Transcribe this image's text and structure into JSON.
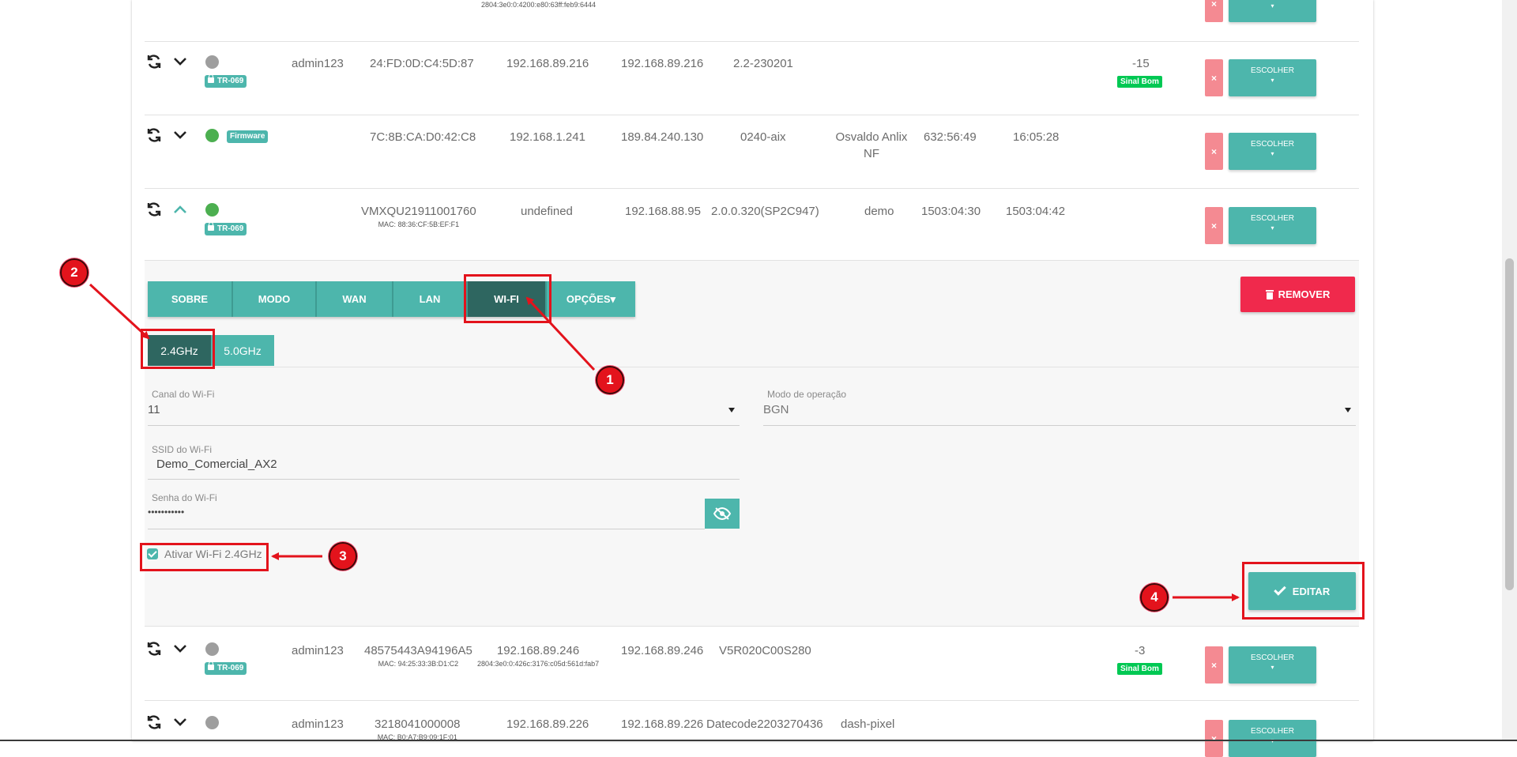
{
  "rows": [
    {
      "id": "row-top-partial",
      "ip_sub": "2804:3e0:0:4200:e80:63ff:feb9:6444"
    },
    {
      "id": "row-1",
      "status": "gray",
      "tag": "TR-069",
      "user": "admin123",
      "mac": "24:FD:0D:C4:5D:87",
      "ip_local": "192.168.89.216",
      "ip_public": "192.168.89.216",
      "version": "2.2-230201",
      "signal": "-15",
      "signal_badge": "Sinal Bom"
    },
    {
      "id": "row-2",
      "status": "green",
      "tag": "Firmware",
      "mac": "7C:8B:CA:D0:42:C8",
      "ip_local": "192.168.1.241",
      "ip_public": "189.84.240.130",
      "version": "0240-aix",
      "name_line1": "Osvaldo Anlix",
      "name_line2": "NF",
      "uptime": "632:56:49",
      "conn_time": "16:05:28"
    },
    {
      "id": "row-3",
      "status": "green",
      "tag": "TR-069",
      "serial": "VMXQU21911001760",
      "serial_sub": "MAC: 88:36:CF:5B:EF:F1",
      "user": "undefined",
      "ip_local": "192.168.88.95",
      "version": "2.0.0.320(SP2C947)",
      "name": "demo",
      "uptime": "1503:04:30",
      "conn_time": "1503:04:42"
    },
    {
      "id": "row-4",
      "status": "gray",
      "tag": "TR-069",
      "user": "admin123",
      "serial": "48575443A94196A5",
      "serial_sub": "MAC: 94:25:33:3B:D1:C2",
      "ip_local": "192.168.89.246",
      "ip_local_sub": "2804:3e0:0:426c:3176:c05d:561d:fab7",
      "ip_public": "192.168.89.246",
      "version": "V5R020C00S280",
      "signal": "-3",
      "signal_badge": "Sinal Bom"
    },
    {
      "id": "row-5",
      "status": "gray",
      "user": "admin123",
      "serial": "3218041000008",
      "serial_sub": "MAC: B0:A7:B9:09:1F:01",
      "ip_local": "192.168.89.226",
      "ip_public": "192.168.89.226",
      "version": "Datecode2203270436",
      "name": "dash-pixel"
    }
  ],
  "actions": {
    "delete_label": "×",
    "choose_label": "ESCOLHER",
    "choose_caret": "▾"
  },
  "detail": {
    "tabs": [
      "SOBRE",
      "MODO",
      "WAN",
      "LAN",
      "WI-FI",
      "OPÇÕES▾"
    ],
    "active_tab": "WI-FI",
    "remove_label": "REMOVER",
    "bands": [
      "2.4GHz",
      "5.0GHz"
    ],
    "active_band": "2.4GHz",
    "channel_label": "Canal do Wi-Fi",
    "channel_value": "11",
    "mode_label": "Modo de operação",
    "mode_value": "BGN",
    "ssid_label": "SSID do Wi-Fi",
    "ssid_value": "Demo_Comercial_AX2",
    "password_label": "Senha do Wi-Fi",
    "password_value": "•••••••••••",
    "enable_label": "Ativar Wi-Fi 2.4GHz",
    "edit_label": "EDITAR"
  },
  "annotations": [
    "1",
    "2",
    "3",
    "4"
  ],
  "colors": {
    "teal": "#4db6ac",
    "teal_dark": "#2e6660",
    "red": "#f0294c",
    "annotation_red": "#e3131c",
    "status_green": "#4caf50",
    "status_gray": "#9e9e9e",
    "signal_green": "#00c853"
  }
}
